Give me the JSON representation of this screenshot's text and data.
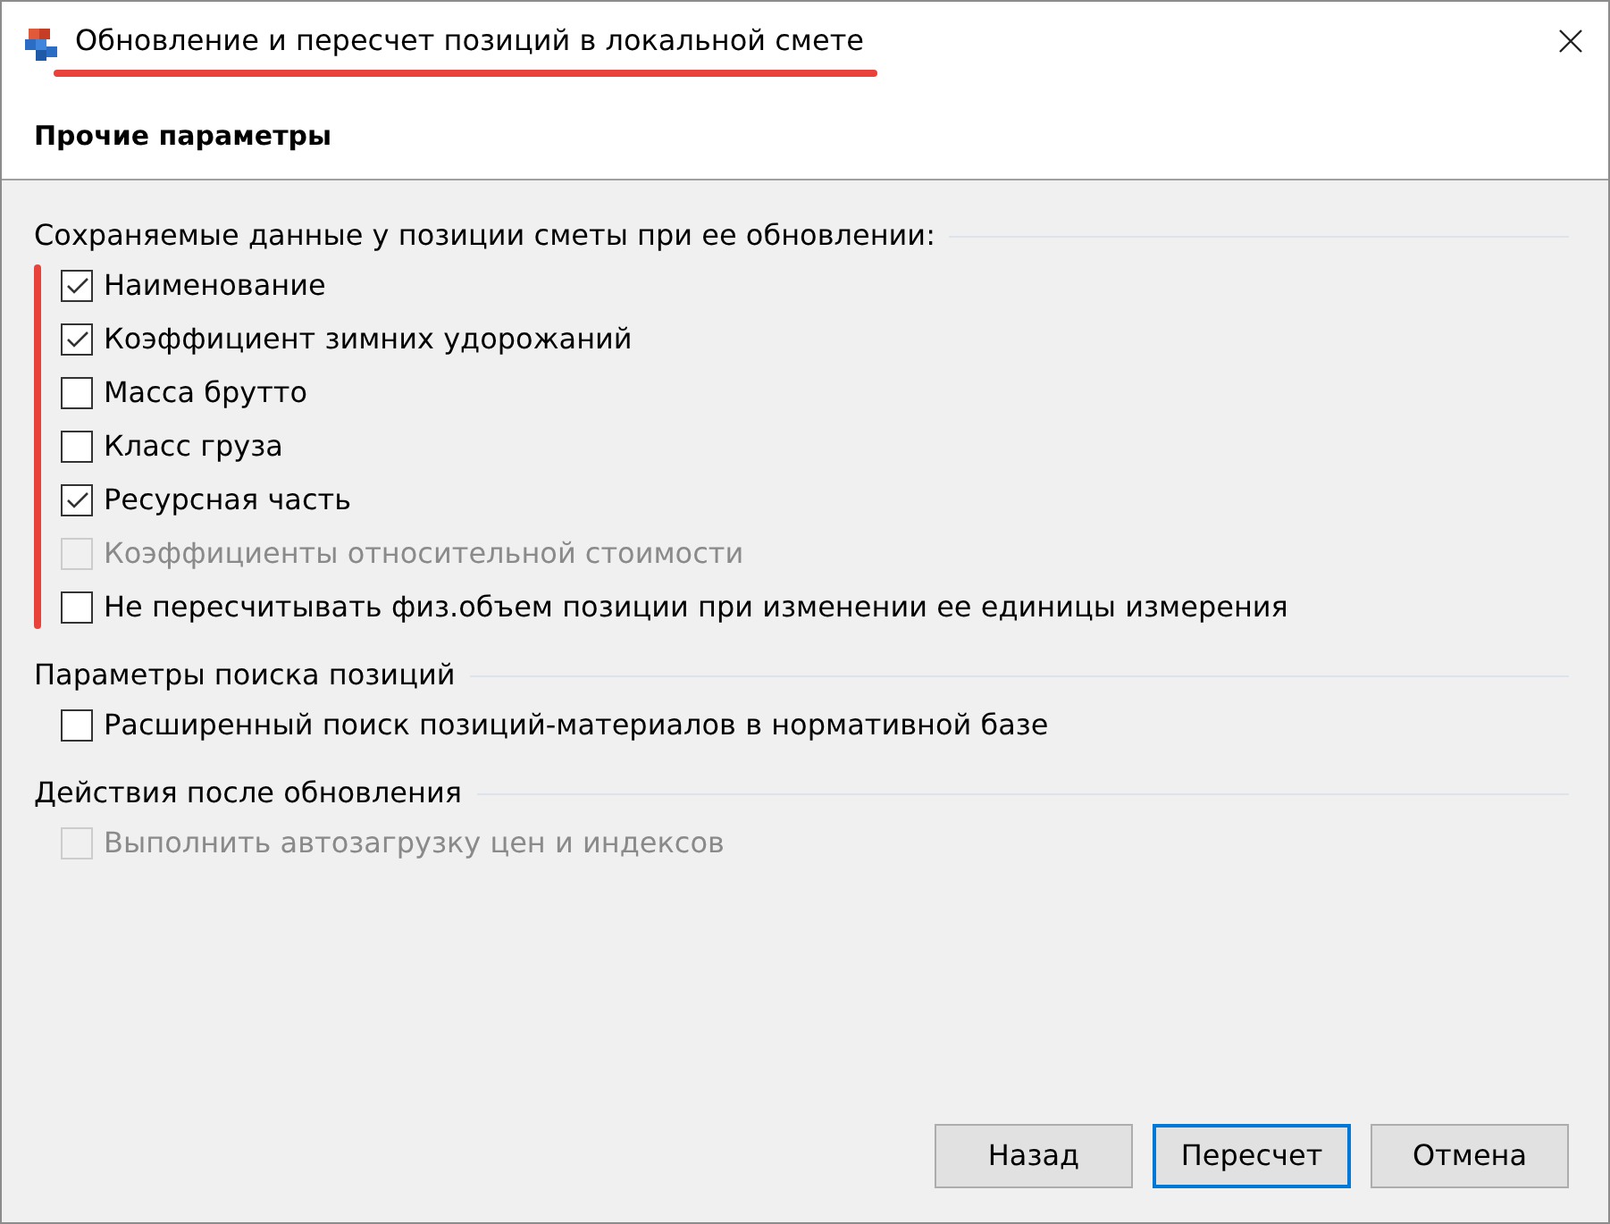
{
  "window": {
    "title": "Обновление и пересчет позиций в локальной смете",
    "title_highlighted": true
  },
  "header": "Прочие параметры",
  "groups": [
    {
      "label": "Сохраняемые данные у позиции сметы при ее обновлении:",
      "highlighted": true,
      "items": [
        {
          "label": "Наименование",
          "checked": true,
          "disabled": false
        },
        {
          "label": "Коэффициент зимних удорожаний",
          "checked": true,
          "disabled": false
        },
        {
          "label": "Масса брутто",
          "checked": false,
          "disabled": false
        },
        {
          "label": "Класс груза",
          "checked": false,
          "disabled": false
        },
        {
          "label": "Ресурсная часть",
          "checked": true,
          "disabled": false
        },
        {
          "label": "Коэффициенты относительной стоимости",
          "checked": false,
          "disabled": true
        },
        {
          "label": "Не пересчитывать физ.объем позиции при изменении ее единицы измерения",
          "checked": false,
          "disabled": false
        }
      ]
    },
    {
      "label": "Параметры поиска позиций",
      "items": [
        {
          "label": "Расширенный поиск позиций-материалов в нормативной базе",
          "checked": false,
          "disabled": false
        }
      ]
    },
    {
      "label": "Действия после обновления",
      "items": [
        {
          "label": "Выполнить автозагрузку цен и индексов",
          "checked": false,
          "disabled": true
        }
      ]
    }
  ],
  "buttons": [
    {
      "label": "Назад",
      "default": false
    },
    {
      "label": "Пересчет",
      "default": true
    },
    {
      "label": "Отмена",
      "default": false
    }
  ]
}
